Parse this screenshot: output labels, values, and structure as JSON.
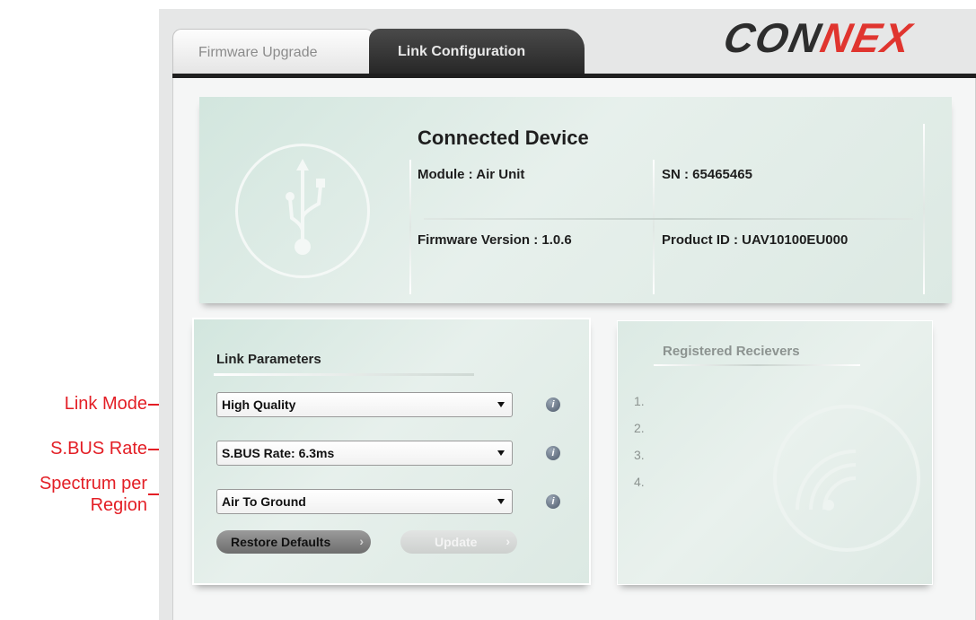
{
  "tabs": {
    "firmware": "Firmware Upgrade",
    "link": "Link Configuration"
  },
  "logo": {
    "part1": "C",
    "part2": "ON",
    "part3": "NEX"
  },
  "device": {
    "title": "Connected Device",
    "module": "Module : Air Unit",
    "sn": "SN : 65465465",
    "firmware": "Firmware Version : 1.0.6",
    "product_id": "Product ID : UAV10100EU000"
  },
  "link_params": {
    "title": "Link Parameters",
    "link_mode": "High Quality",
    "sbus_rate": "S.BUS Rate: 6.3ms",
    "spectrum": "Air To Ground",
    "info_glyph": "i",
    "restore_label": "Restore Defaults",
    "update_label": "Update",
    "chevron": "›"
  },
  "receivers": {
    "title": "Registered Recievers",
    "items": [
      "1.",
      "2.",
      "3.",
      "4."
    ]
  },
  "annotations": {
    "link_mode": "Link Mode",
    "sbus_rate": "S.BUS Rate",
    "spectrum_line1": "Spectrum per",
    "spectrum_line2": "Region"
  },
  "colors": {
    "accent_red": "#e31e25",
    "tab_active": "#262626",
    "card_green": "#d2e6de"
  }
}
